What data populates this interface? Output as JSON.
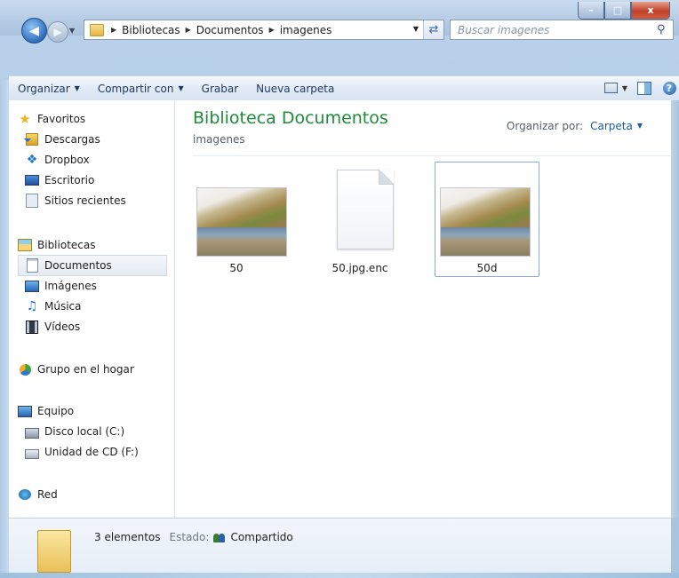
{
  "window": {
    "minimize_label": "–",
    "maximize_label": "□",
    "close_label": "x"
  },
  "nav": {
    "back_icon": "back-arrow-icon",
    "forward_icon": "forward-arrow-icon",
    "address_crumbs": [
      "Bibliotecas",
      "Documentos",
      "imagenes"
    ],
    "search_placeholder": "Buscar imagenes"
  },
  "toolbar": {
    "organize": "Organizar",
    "share": "Compartir con",
    "burn": "Grabar",
    "new_folder": "Nueva carpeta"
  },
  "sidebar": {
    "favorites": {
      "label": "Favoritos",
      "items": [
        "Descargas",
        "Dropbox",
        "Escritorio",
        "Sitios recientes"
      ]
    },
    "libraries": {
      "label": "Bibliotecas",
      "items": [
        "Documentos",
        "Imágenes",
        "Música",
        "Vídeos"
      ],
      "selected": "Documentos"
    },
    "homegroup": "Grupo en el hogar",
    "computer": {
      "label": "Equipo",
      "items": [
        "Disco local (C:)",
        "Unidad de CD (F:)"
      ]
    },
    "network": "Red"
  },
  "content": {
    "title": "Biblioteca Documentos",
    "subtitle": "imagenes",
    "arrange_label": "Organizar por:",
    "arrange_value": "Carpeta",
    "files": [
      {
        "name": "50",
        "type": "image"
      },
      {
        "name": "50.jpg.enc",
        "type": "file"
      },
      {
        "name": "50d",
        "type": "image",
        "selected": true
      }
    ]
  },
  "details": {
    "count": "3 elementos",
    "state_label": "Estado:",
    "state_value": "Compartido"
  },
  "colors": {
    "title_green": "#1e8c3a",
    "link_blue": "#1d5a9a",
    "toolbar_text": "#1e395b"
  }
}
